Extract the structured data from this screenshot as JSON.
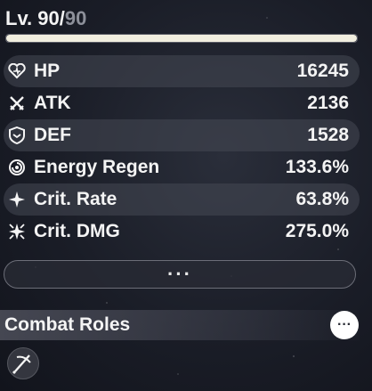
{
  "level": {
    "prefix": "Lv. 90/",
    "max": "90",
    "progress": 1.0
  },
  "stats": [
    {
      "label": "HP",
      "value": "16245",
      "icon": "hp-icon"
    },
    {
      "label": "ATK",
      "value": "2136",
      "icon": "atk-icon"
    },
    {
      "label": "DEF",
      "value": "1528",
      "icon": "def-icon"
    },
    {
      "label": "Energy Regen",
      "value": "133.6%",
      "icon": "energy-regen-icon"
    },
    {
      "label": "Crit. Rate",
      "value": "63.8%",
      "icon": "crit-rate-icon"
    },
    {
      "label": "Crit. DMG",
      "value": "275.0%",
      "icon": "crit-dmg-icon"
    }
  ],
  "more_button": {
    "label": "···"
  },
  "combat_roles": {
    "title": "Combat Roles",
    "info_label": "···",
    "role_icon": "role-icon"
  },
  "colors": {
    "text": "#f4f4f4",
    "muted": "#8d909a",
    "bar_fill": "#f1eedf"
  }
}
